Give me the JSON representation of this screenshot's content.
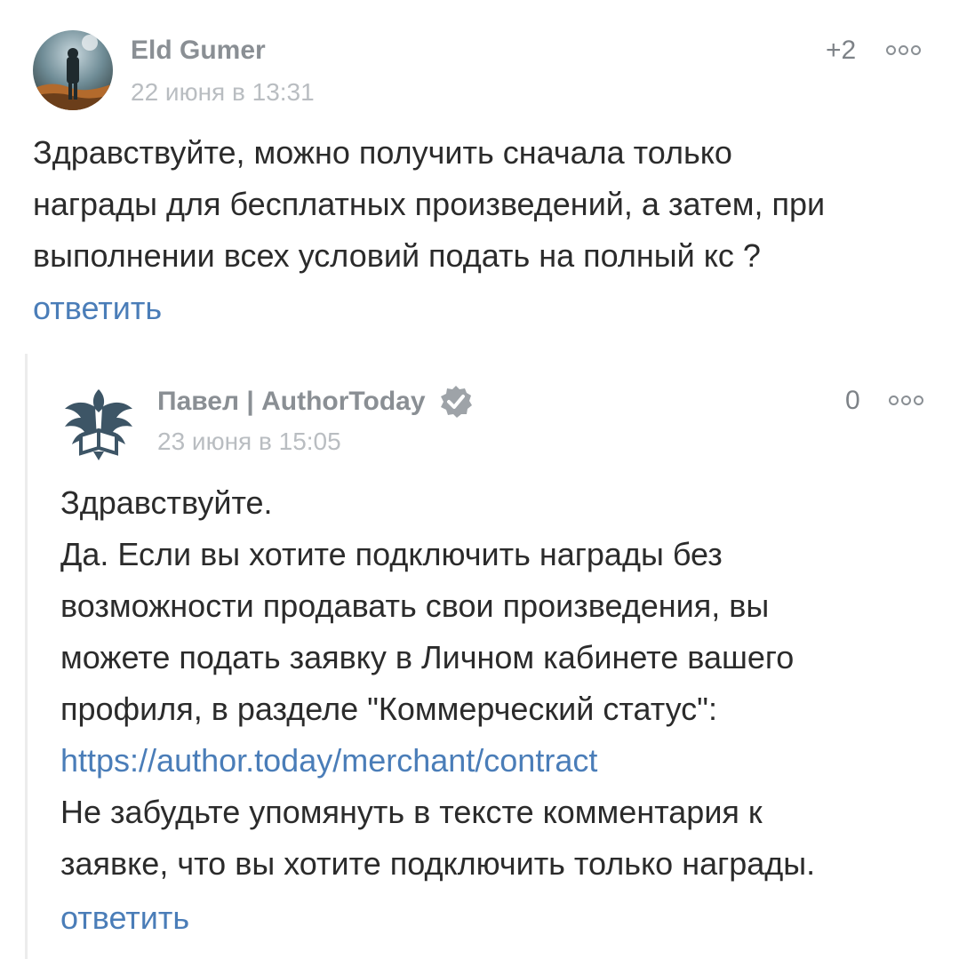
{
  "comments": [
    {
      "author": "Eld Gumer",
      "date": "22 июня в 13:31",
      "score": "+2",
      "lines": [
        "Здравствуйте, можно получить сначала только",
        "награды для бесплатных произведений, а затем, при",
        "выполнении всех условий подать на полный кс ?"
      ],
      "reply_label": "ответить"
    },
    {
      "author": "Павел | AuthorToday",
      "date": "23 июня в 15:05",
      "score": "0",
      "lines": [
        "Здравствуйте.",
        "Да. Если вы хотите подключить награды без",
        "возможности продавать свои произведения, вы",
        "можете подать заявку в Личном кабинете вашего",
        "профиля, в разделе \"Коммерческий статус\":"
      ],
      "link": "https://author.today/merchant/contract",
      "lines_after": [
        "Не забудьте упомянуть в тексте комментария к",
        "заявке, что вы хотите подключить только награды."
      ],
      "reply_label": "ответить"
    }
  ],
  "icons": {
    "more": "more-options-icon",
    "verified": "verified-badge-icon"
  },
  "colors": {
    "link": "#4a7db8",
    "author": "#8a8f94",
    "date": "#b9bdc1",
    "text": "#2b2b2b"
  }
}
